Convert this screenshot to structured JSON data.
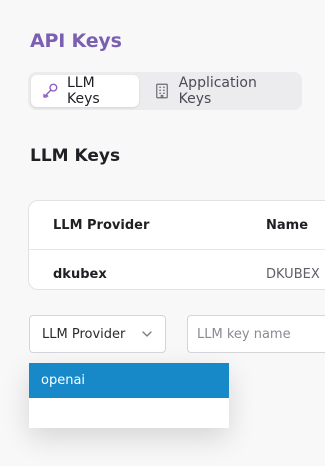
{
  "page": {
    "title": "API Keys"
  },
  "tabs": [
    {
      "label": "LLM Keys",
      "icon": "key-icon",
      "active": true
    },
    {
      "label": "Application Keys",
      "icon": "building-icon",
      "active": false
    }
  ],
  "section": {
    "title": "LLM Keys"
  },
  "table": {
    "columns": [
      "LLM Provider",
      "Name"
    ],
    "rows": [
      {
        "provider": "dkubex",
        "name": "DKUBEX"
      }
    ]
  },
  "form": {
    "provider_select": {
      "label": "LLM Provider",
      "icon": "chevron-down-icon"
    },
    "key_name_input": {
      "placeholder": "LLM key name",
      "value": ""
    }
  },
  "dropdown": {
    "options": [
      {
        "label": "openai",
        "highlighted": true
      }
    ]
  },
  "colors": {
    "title": "#7b5fb0",
    "tab_icon": "#8a5cc2",
    "highlight": "#1789c9"
  }
}
